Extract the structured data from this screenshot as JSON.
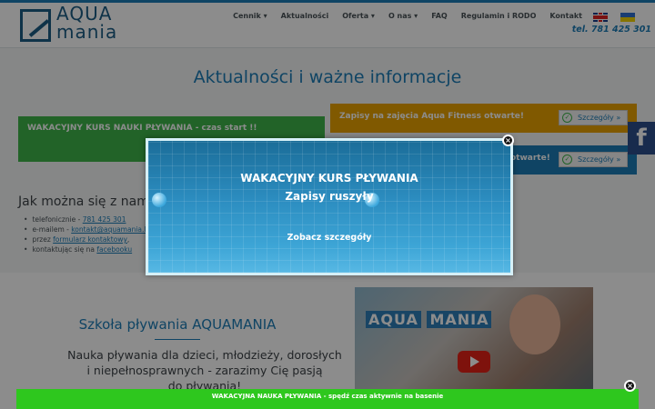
{
  "header": {
    "logo_line1": "AQUA",
    "logo_line2": "mania",
    "nav": [
      "Cennik ▾",
      "Aktualności",
      "Oferta ▾",
      "O nas ▾",
      "FAQ",
      "Regulamin i RODO",
      "Kontakt"
    ],
    "phone": "tel. 781 425 301"
  },
  "main": {
    "title": "Aktualności i ważne informacje",
    "promo_green": "WAKACYJNY KURS NAUKI PŁYWANIA - czas start !!",
    "promo_orange": "Zapisy na zajęcia Aqua Fitness otwarte!",
    "promo_blue": "otwarte!",
    "more_label": "Szczegóły »",
    "contact_heading": "Jak można się z nami sk",
    "contact_items": {
      "phone_prefix": "telefonicznie - ",
      "phone": "781 425 301",
      "email_prefix": "e-mailem - ",
      "email": "kontakt@aquamania.lub",
      "form_prefix": "przez ",
      "form": "formularz kontaktowy",
      "form_suffix": ",",
      "fb_prefix": "kontaktując się na ",
      "fb": "facebooku"
    }
  },
  "school": {
    "title": "Szkoła pływania AQUAMANIA",
    "line1": "Nauka pływania dla dzieci, młodzieży, dorosłych",
    "line2": "i niepełnosprawnych - zarazimy Cię pasją",
    "line3": "do pływania!",
    "video_logo_a": "AQUA",
    "video_logo_b": "MANIA"
  },
  "modal": {
    "title": "WAKACYJNY KURS PŁYWANIA",
    "subtitle": "Zapisy ruszyły",
    "link": "Zobacz szczegóły",
    "close": "×"
  },
  "bottombar": {
    "text": "WAKACYJNA NAUKA PŁYWANIA - spędź czas aktywnie na basenie",
    "close": "×"
  },
  "social": {
    "facebook": "f"
  },
  "colors": {
    "brand": "#1d7db7",
    "green": "#3fb44a",
    "orange": "#e9a300",
    "bar_green": "#2ec71e"
  }
}
